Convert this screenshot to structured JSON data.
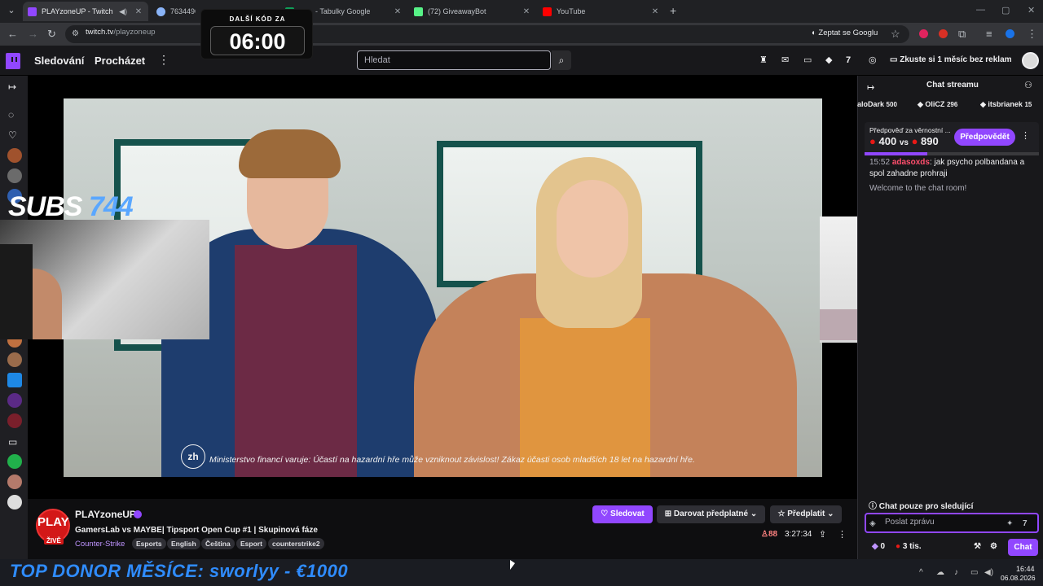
{
  "browser": {
    "tabs": [
      {
        "title": "PLAYzoneUP - Twitch",
        "color": "#9147ff"
      },
      {
        "title": "763449653",
        "color": "#8ab4f8"
      },
      {
        "title": "- Tabulky Google",
        "color": "#0f9d58"
      },
      {
        "title": "(72) GiveawayBot",
        "color": "#57f287"
      },
      {
        "title": "YouTube",
        "color": "#ff0000"
      }
    ],
    "url_host": "twitch.tv",
    "url_path": "/playzoneup",
    "ask_google": "Zeptat se Googlu"
  },
  "countdown": {
    "label": "DALŠÍ KÓD ZA",
    "value": "06:00"
  },
  "twitch_nav": {
    "following": "Sledování",
    "browse": "Procházet",
    "search_placeholder": "Hledat",
    "promo": "Zkuste si 1 měsíc bez reklam"
  },
  "overlay": {
    "subs_label": "SUBS",
    "subs_count": "744",
    "subtitle": "Ministerstvo financí varuje: Účastí na hazardní hře může vzniknout závislost! Zákaz účasti osob mladších 18 let na hazardní hře.",
    "zh_logo": "zh"
  },
  "channel": {
    "avatar_text": "PLAY",
    "live_badge": "ŽIVĚ",
    "name": "PLAYzoneUP",
    "title": "GamersLab vs MAYBE| Tipsport Open Cup #1 | Skupinová fáze",
    "game": "Counter-Strike",
    "tags": [
      "Esports",
      "English",
      "Čeština",
      "Esport",
      "counterstrike2"
    ],
    "follow": "Sledovat",
    "gift_sub": "Darovat předplatné",
    "subscribe": "Předplatit",
    "viewers": "88",
    "uptime": "3:27:34"
  },
  "chat": {
    "header": "Chat streamu",
    "leaderboard": [
      {
        "name": "aloDark",
        "points": "500"
      },
      {
        "name": "OliCZ",
        "points": "296"
      },
      {
        "name": "itsbrianek",
        "points": "15"
      }
    ],
    "prediction": {
      "label": "Předpověď za věrnostní ...",
      "left": "400",
      "vs": "vs",
      "right": "890",
      "button": "Předpovědět",
      "progress": 0.36
    },
    "messages": [
      {
        "time": "15:52",
        "user": "adasoxds",
        "text": ": jak psycho polbandana a spol zahadne prohraji"
      }
    ],
    "welcome": "Welcome to the chat room!",
    "followers_only": "Chat pouze pro sledující",
    "input_placeholder": "Poslat zprávu",
    "bits": "0",
    "channel_points": "3 tis.",
    "send": "Chat"
  },
  "taskbar": {
    "ticker": "TOP DONOR MĚSÍCE: sworlyy - €1000",
    "time": "16:44",
    "date": "06.08.2026"
  }
}
